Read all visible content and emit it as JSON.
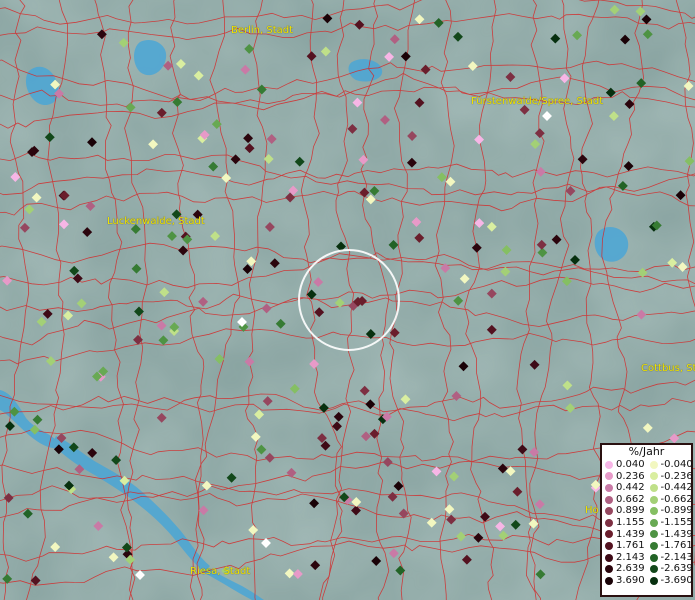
{
  "map": {
    "cities": [
      {
        "label": "Berlin, Stadt"
      },
      {
        "label": "Fürstenwalde/Spree, Stadt"
      },
      {
        "label": "Luckenwalde, Stadt"
      },
      {
        "label": "Cottbus, Stadt"
      },
      {
        "label": "Riesa, Stadt"
      },
      {
        "label": "Ho"
      }
    ]
  },
  "legend": {
    "title": "%/Jahr",
    "positive": [
      "0.040",
      "0.236",
      "0.442",
      "0.662",
      "0.899",
      "1.155",
      "1.439",
      "1.761",
      "2.143",
      "2.639",
      "3.690"
    ],
    "negative": [
      "-0.040",
      "-0.236",
      "-0.442",
      "-0.662",
      "-0.899",
      "-1.155",
      "-1.439",
      "-1.761",
      "-2.143",
      "-2.639",
      "-3.690"
    ],
    "positive_colors": [
      "#f7b6e6",
      "#e79ac8",
      "#c97aa6",
      "#b06082",
      "#96475f",
      "#7d2f42",
      "#6a1e2c",
      "#541220",
      "#3e0a16",
      "#2b050d",
      "#1a0207"
    ],
    "negative_colors": [
      "#f2f7c0",
      "#d9eea0",
      "#bfe089",
      "#a3d076",
      "#85bf63",
      "#68a953",
      "#4e9343",
      "#367b33",
      "#226326",
      "#12481a",
      "#07300f"
    ]
  }
}
